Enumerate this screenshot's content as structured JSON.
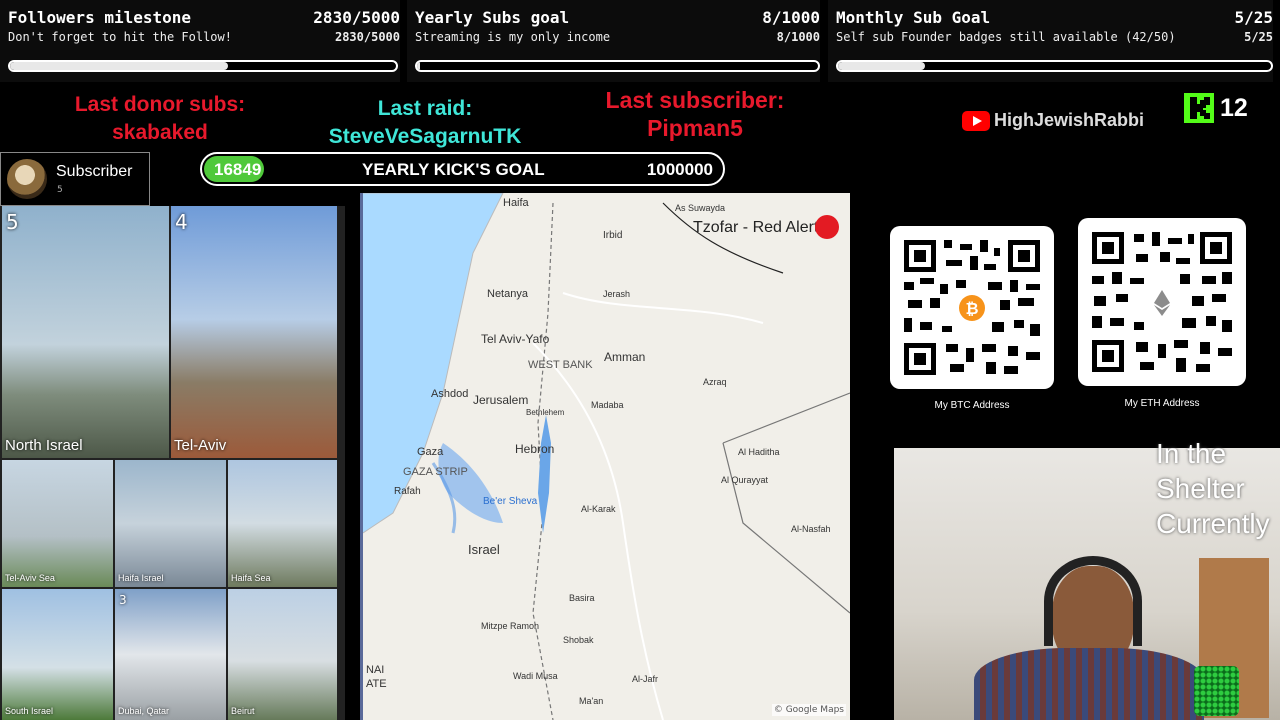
{
  "goals": [
    {
      "title": "Followers milestone",
      "count": "2830/5000",
      "subtitle": "Don't forget to hit the Follow!",
      "count2": "2830/5000",
      "progress": 0.566
    },
    {
      "title": "Yearly Subs goal",
      "count": "8/1000",
      "subtitle": "Streaming is my only income",
      "count2": "8/1000",
      "progress": 0.008
    },
    {
      "title": "Monthly Sub Goal",
      "count": "5/25",
      "subtitle": "Self sub Founder badges still available (42/50)",
      "count2": "5/25",
      "progress": 0.2
    }
  ],
  "last": {
    "donor_label": "Last donor subs:",
    "donor_name": "skabaked",
    "raid_label": "Last raid:",
    "raid_name": "SteveVeSagarnuTK",
    "sub_label": "Last subscriber:",
    "sub_name": "Pipman5"
  },
  "subscriber_box": {
    "label": "Subscriber",
    "count": "5"
  },
  "kick_goal": {
    "current": "16849",
    "label": "YEARLY KICK'S GOAL",
    "target": "1000000"
  },
  "youtube_handle": "HighJewishRabbi",
  "kick_viewers": "12",
  "cameras": [
    {
      "num": "5",
      "label": "North Israel"
    },
    {
      "num": "4",
      "label": "Tel-Aviv"
    },
    {
      "num": "",
      "label": "Tel-Aviv Sea"
    },
    {
      "num": "",
      "label": "Haifa Israel"
    },
    {
      "num": "",
      "label": "Haifa Sea"
    },
    {
      "num": "",
      "label": "South Israel"
    },
    {
      "num": "3",
      "label": "Dubai, Qatar"
    },
    {
      "num": "",
      "label": "Beirut"
    }
  ],
  "map": {
    "alert_title": "Tzofar - Red Alert",
    "credit": "© Google Maps",
    "places": [
      "Haifa",
      "Netanya",
      "Tel Aviv-Yafo",
      "WEST BANK",
      "Amman",
      "Ashdod",
      "Jerusalem",
      "Bethlehem",
      "Gaza",
      "GAZA STRIP",
      "Rafah",
      "Hebron",
      "Be'er Sheva",
      "Israel",
      "Irbid",
      "Jerash",
      "Madaba",
      "Azraq",
      "Al Haditha",
      "Al Qurayyat",
      "Al-Karak",
      "Basira",
      "Shobak",
      "Wadi Musa",
      "Mitzpe Ramon",
      "Al-Jafr",
      "Ma'an",
      "As Suwayda",
      "Al-Nasfah",
      "NAI ATE"
    ]
  },
  "qr_codes": [
    {
      "label": "My BTC Address",
      "icon": "bitcoin-icon",
      "color": "#f7931a"
    },
    {
      "label": "My ETH Address",
      "icon": "ethereum-icon",
      "color": "#8c8c8c"
    }
  ],
  "shelter_text": [
    "In the",
    "Shelter",
    "Currently"
  ],
  "colors": {
    "donor": "#e8192c",
    "raid": "#3fe6d8",
    "subscriber": "#e8192c",
    "kick_green": "#53fc18",
    "youtube_red": "#ff0000"
  }
}
